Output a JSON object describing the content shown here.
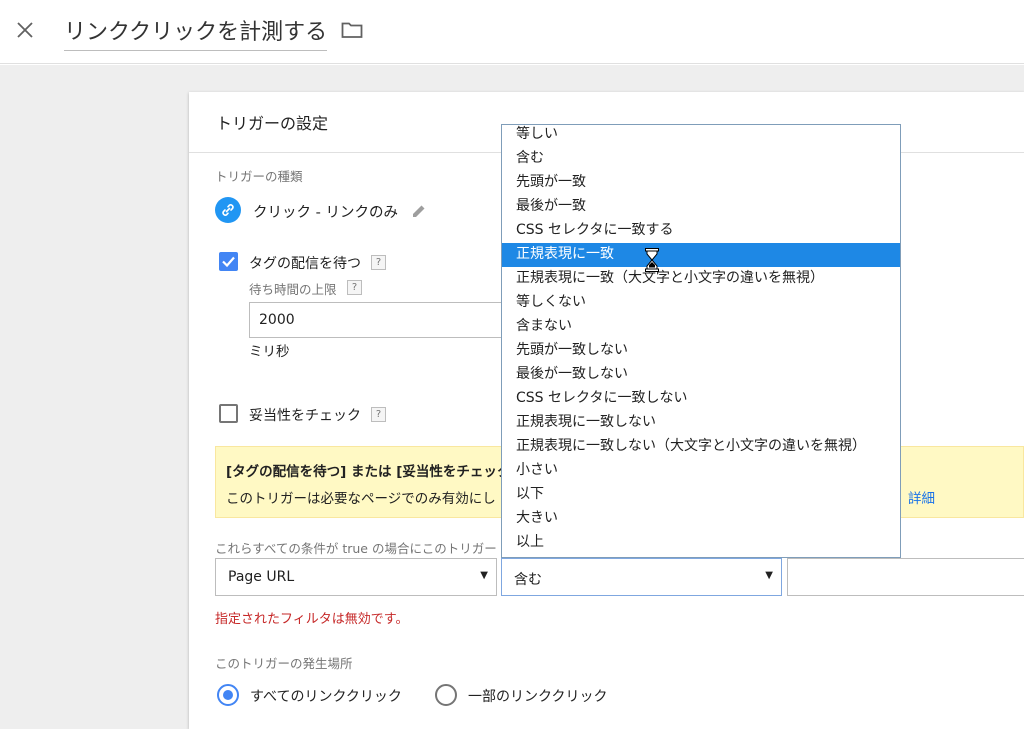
{
  "header": {
    "title": "リンククリックを計測する",
    "close_icon": "close-icon",
    "folder_icon": "folder-icon"
  },
  "card": {
    "title": "トリガーの設定",
    "trigger_type_label": "トリガーの種類",
    "trigger_type_value": "クリック - リンクのみ",
    "wait_tags": {
      "label": "タグの配信を待つ",
      "checked": true,
      "help": "?",
      "max_wait_label": "待ち時間の上限",
      "max_wait_help": "?",
      "max_wait_value": "2000",
      "unit": "ミリ秒"
    },
    "check_validation": {
      "label": "妥当性をチェック",
      "checked": false,
      "help": "?"
    },
    "warning": {
      "title": "[タグの配信を待つ] または [妥当性をチェック",
      "body": "このトリガーは必要なページでのみ有効にし",
      "link": "詳細"
    },
    "conditions_label": "これらすべての条件が true の場合にこのトリガー",
    "filter": {
      "variable": "Page URL",
      "operator": "含む",
      "value": ""
    },
    "error": "指定されたフィルタは無効です。",
    "fire_on_label": "このトリガーの発生場所",
    "fire_on": {
      "all_label": "すべてのリンククリック",
      "some_label": "一部のリンククリック",
      "selected": "all"
    }
  },
  "dropdown": {
    "selected_index": 5,
    "options": [
      "等しい",
      "含む",
      "先頭が一致",
      "最後が一致",
      "CSS セレクタに一致する",
      "正規表現に一致",
      "正規表現に一致（大文字と小文字の違いを無視）",
      "等しくない",
      "含まない",
      "先頭が一致しない",
      "最後が一致しない",
      "CSS セレクタに一致しない",
      "正規表現に一致しない",
      "正規表現に一致しない（大文字と小文字の違いを無視）",
      "小さい",
      "以下",
      "大きい",
      "以上"
    ]
  },
  "colors": {
    "accent": "#4285f4",
    "selected_row": "#1e88e5",
    "error": "#c62828",
    "warning_bg": "#fff9c4",
    "link": "#1a73e8"
  },
  "icons": {
    "trigger": "link-icon",
    "edit": "pencil-icon",
    "cursor": "hourglass-icon"
  }
}
